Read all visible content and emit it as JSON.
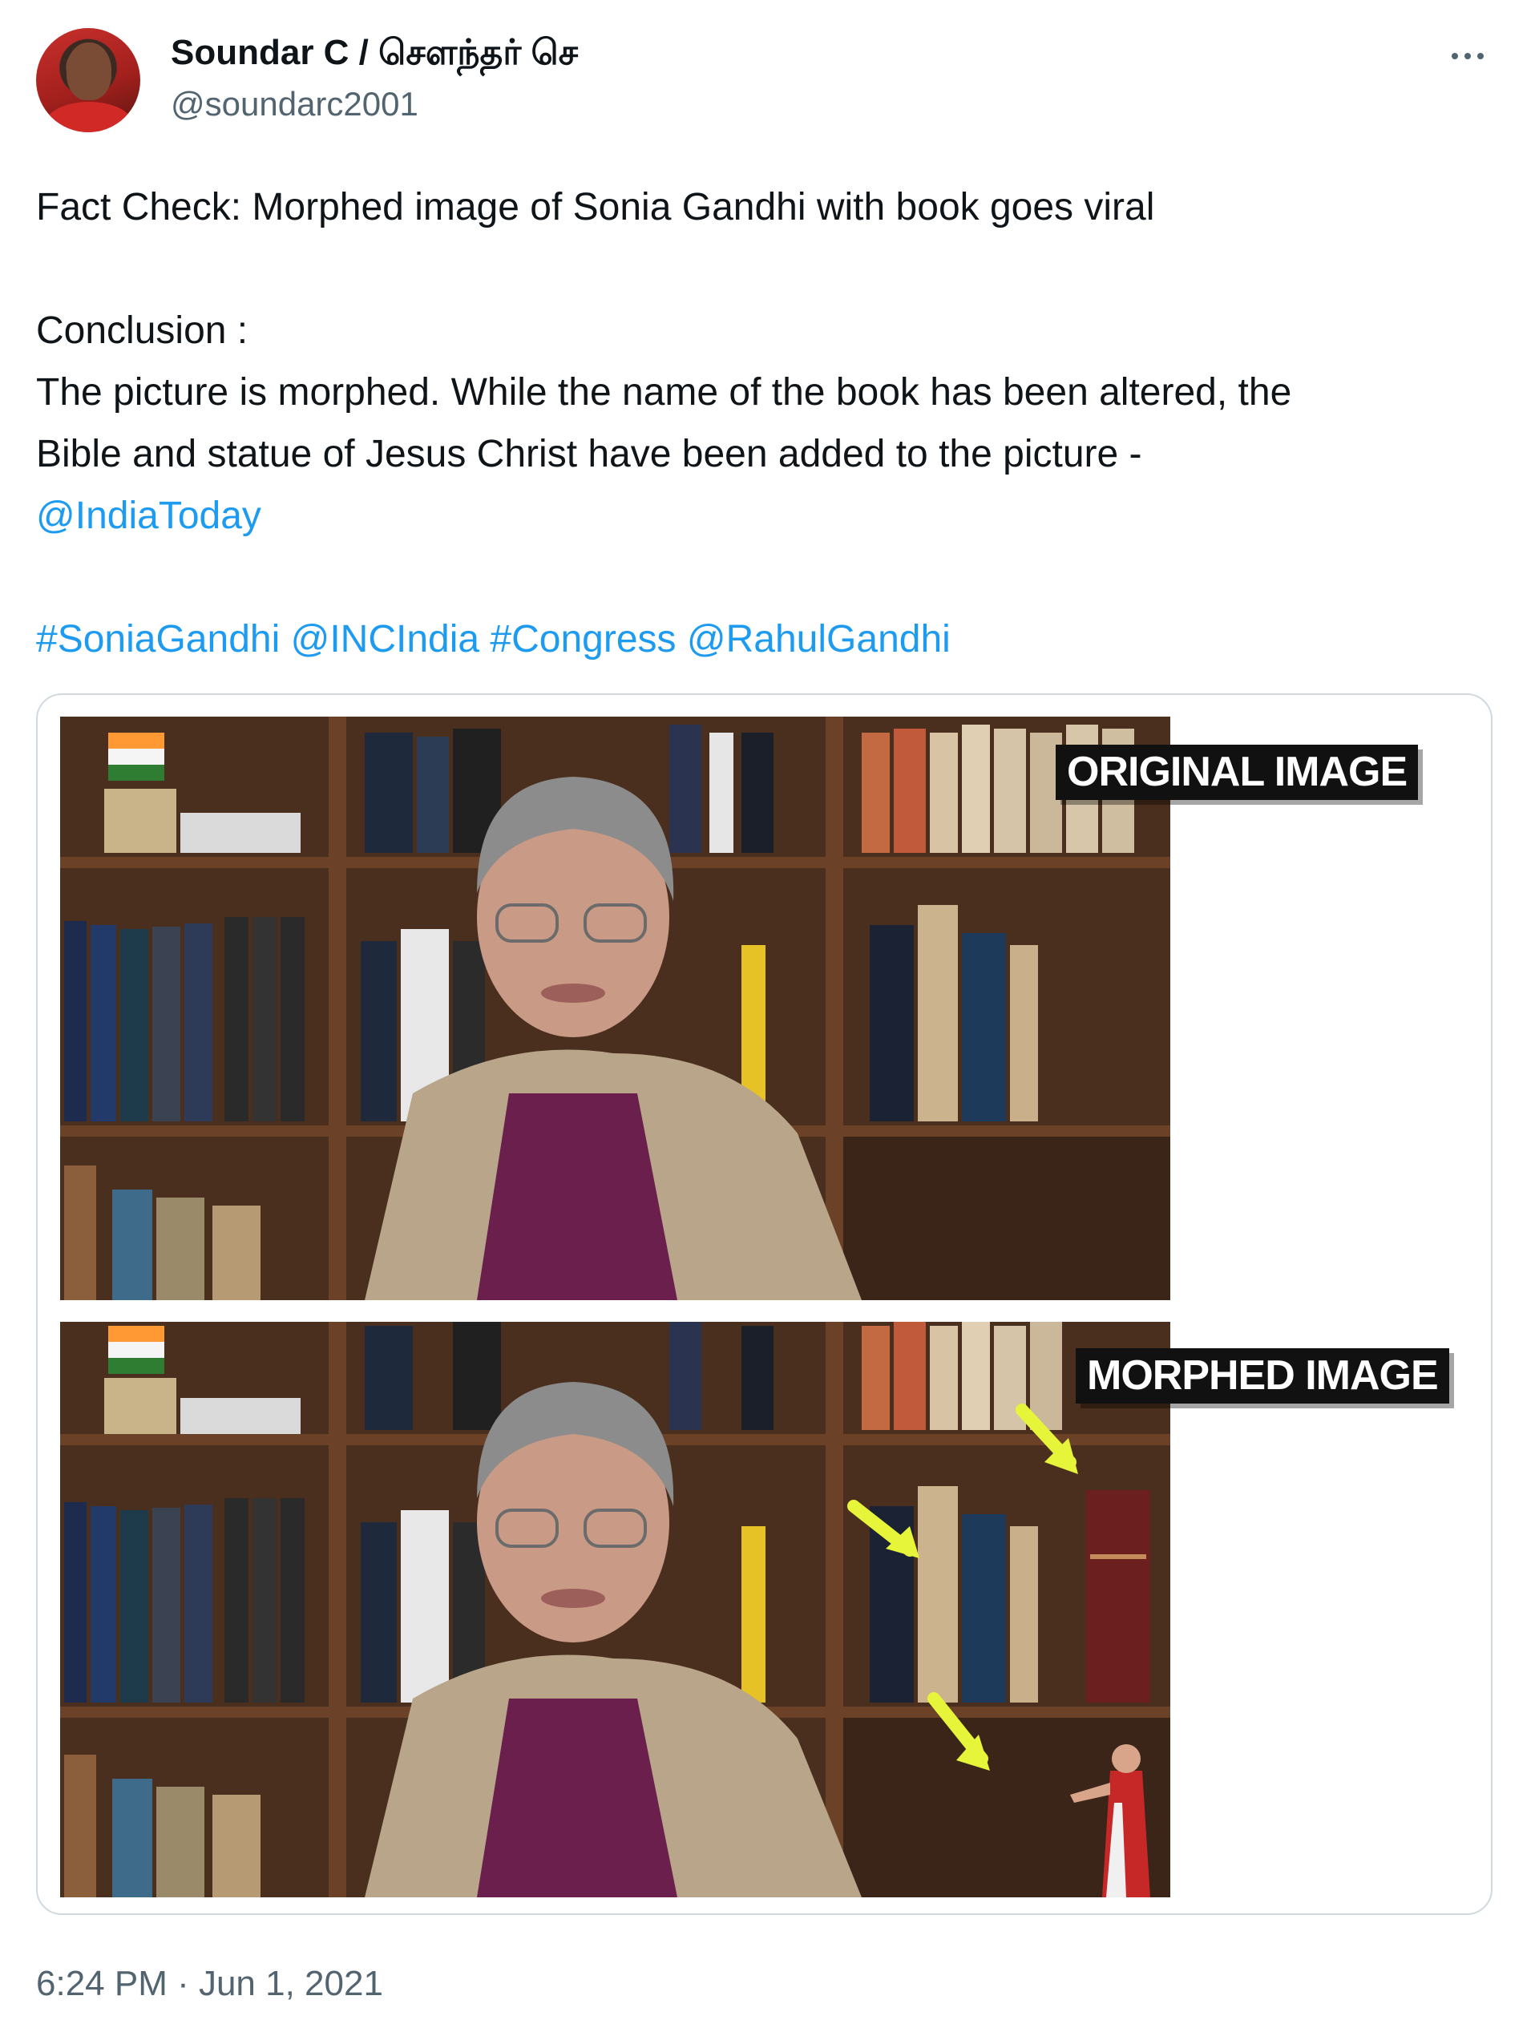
{
  "author": {
    "display_name": "Soundar C / சௌந்தர் செ",
    "handle": "@soundarc2001"
  },
  "more_icon": "more-horizontal-icon",
  "tweet": {
    "line1": "Fact Check: Morphed image of Sonia Gandhi with book goes viral",
    "line2": "Conclusion :",
    "line3": "The picture is morphed. While the name of the book has been altered, the",
    "line4": "Bible and statue of Jesus Christ have been added to the picture -",
    "mention_indiatoday": "@IndiaToday",
    "tags": {
      "tag1": "#SoniaGandhi",
      "tag2": "@INCIndia",
      "tag3": "#Congress",
      "tag4": "@RahulGandhi"
    }
  },
  "media": {
    "label_original": "ORIGINAL IMAGE",
    "label_morphed": "MORPHED IMAGE"
  },
  "timestamp": "6:24 PM · Jun 1, 2021",
  "colors": {
    "link": "#1d9bf0",
    "secondary_text": "#536471",
    "arrow": "#e6f53a"
  }
}
